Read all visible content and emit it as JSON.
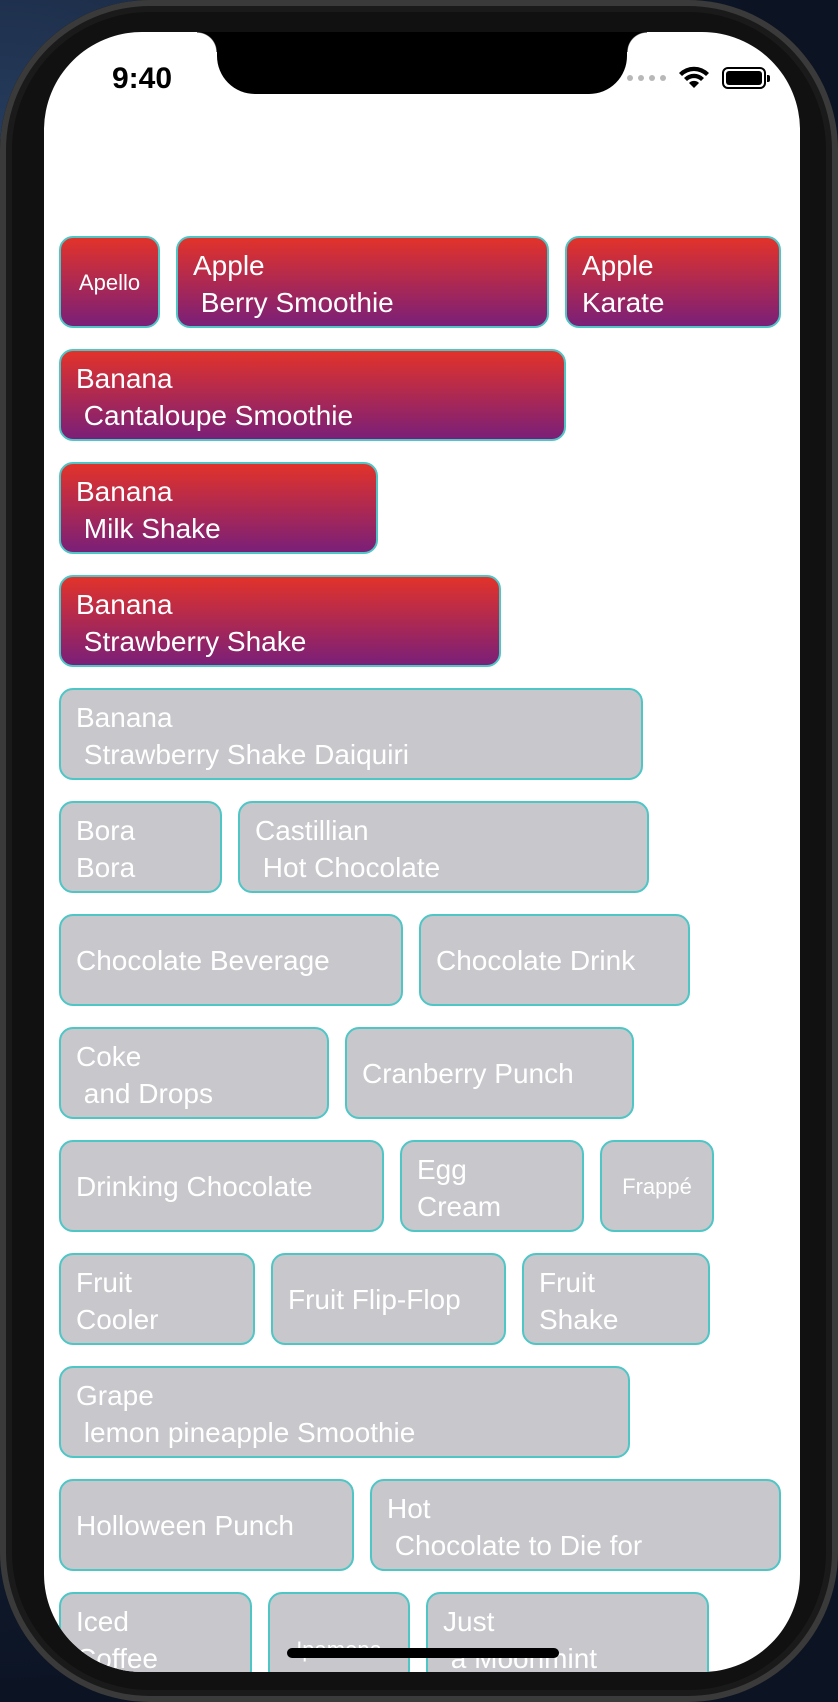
{
  "status_bar": {
    "time": "9:40"
  },
  "chips": [
    {
      "label": "Apello",
      "selected": true
    },
    {
      "label": "Apple\n Berry Smoothie",
      "selected": true
    },
    {
      "label": "Apple\nKarate",
      "selected": true
    },
    {
      "label": "Banana\n Cantaloupe Smoothie",
      "selected": true
    },
    {
      "label": "Banana\n Milk Shake",
      "selected": true
    },
    {
      "label": "Banana\n Strawberry Shake",
      "selected": true
    },
    {
      "label": "Banana\n Strawberry Shake Daiquiri",
      "selected": false
    },
    {
      "label": "Bora\nBora",
      "selected": false
    },
    {
      "label": "Castillian\n Hot Chocolate",
      "selected": false
    },
    {
      "label": "Chocolate Beverage",
      "selected": false
    },
    {
      "label": "Chocolate Drink",
      "selected": false
    },
    {
      "label": "Coke\n and Drops",
      "selected": false
    },
    {
      "label": "Cranberry Punch",
      "selected": false
    },
    {
      "label": "Drinking Chocolate",
      "selected": false
    },
    {
      "label": "Egg\nCream",
      "selected": false
    },
    {
      "label": "Frappé",
      "selected": false
    },
    {
      "label": "Fruit\nCooler",
      "selected": false
    },
    {
      "label": "Fruit Flip-Flop",
      "selected": false
    },
    {
      "label": "Fruit\nShake",
      "selected": false
    },
    {
      "label": "Grape\n lemon pineapple Smoothie",
      "selected": false
    },
    {
      "label": "Holloween Punch",
      "selected": false
    },
    {
      "label": "Hot\n Chocolate to Die for",
      "selected": false
    },
    {
      "label": "Iced\nCoffee",
      "selected": false
    },
    {
      "label": "Ipamena",
      "selected": false
    },
    {
      "label": "Just\n a Moonmint",
      "selected": false
    }
  ],
  "colors": {
    "selected_top": "#e2332a",
    "selected_bottom": "#7a1f78",
    "unselected": "#c7c7cc",
    "border": "#4ec6c6"
  }
}
